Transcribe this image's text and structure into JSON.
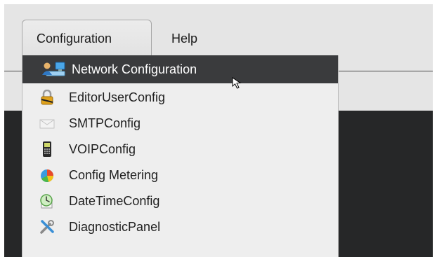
{
  "menubar": {
    "items": [
      {
        "label": "Configuration",
        "state": "open"
      },
      {
        "label": "Help"
      }
    ]
  },
  "dropdown": {
    "items": [
      {
        "label": "Network Configuration",
        "icon": "network-computers-icon",
        "selected": true
      },
      {
        "label": "EditorUserConfig",
        "icon": "padlock-icon"
      },
      {
        "label": "SMTPConfig",
        "icon": "envelope-icon"
      },
      {
        "label": "VOIPConfig",
        "icon": "phone-icon"
      },
      {
        "label": "Config Metering",
        "icon": "pie-chart-icon"
      },
      {
        "label": "DateTimeConfig",
        "icon": "clock-icon"
      },
      {
        "label": "DiagnosticPanel",
        "icon": "tools-icon"
      }
    ]
  },
  "colors": {
    "selected_bg": "#3a3b3d",
    "menu_bg": "#eeeeee",
    "window_bg": "#e5e5e5",
    "dark_panel": "#262728"
  }
}
